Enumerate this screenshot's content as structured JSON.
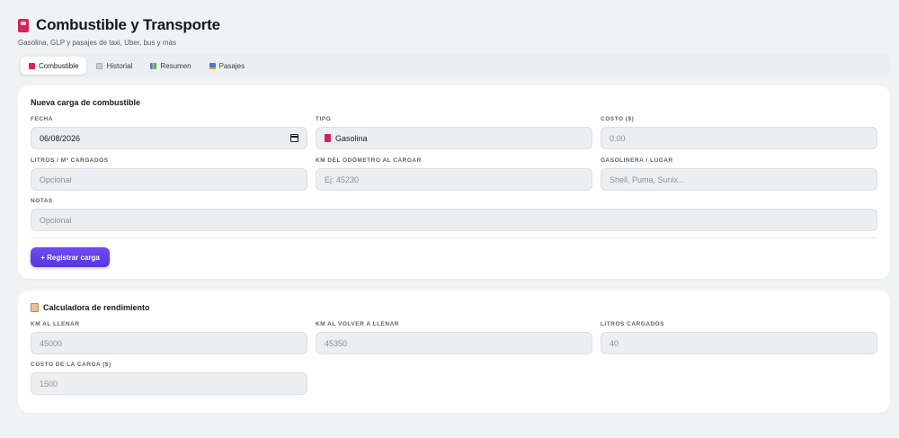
{
  "header": {
    "title": "Combustible y Transporte",
    "subtitle": "Gasolina, GLP y pasajes de taxi, Uber, bus y más"
  },
  "tabs": [
    {
      "label": "Combustible",
      "icon": "fuel-pump-icon",
      "active": true
    },
    {
      "label": "Historial",
      "icon": "clipboard-icon",
      "active": false
    },
    {
      "label": "Resumen",
      "icon": "bar-chart-icon",
      "active": false
    },
    {
      "label": "Pasajes",
      "icon": "bus-icon",
      "active": false
    }
  ],
  "fuel_form": {
    "title": "Nueva carga de combustible",
    "fecha": {
      "label": "FECHA",
      "value": "06/08/2026"
    },
    "tipo": {
      "label": "TIPO",
      "value": "Gasolina"
    },
    "costo": {
      "label": "COSTO ($)",
      "placeholder": "0.00"
    },
    "litros": {
      "label": "LITROS / M³ CARGADOS",
      "placeholder": "Opcional"
    },
    "km": {
      "label": "KM DEL ODÓMETRO AL CARGAR",
      "placeholder": "Ej: 45230"
    },
    "gasolinera": {
      "label": "GASOLINERA / LUGAR",
      "placeholder": "Shell, Puma, Sunix..."
    },
    "notas": {
      "label": "NOTAS",
      "placeholder": "Opcional"
    },
    "submit_label": "+ Registrar carga"
  },
  "calculator": {
    "title": "Calculadora de rendimiento",
    "km_llenar": {
      "label": "KM AL LLENAR",
      "placeholder": "45000"
    },
    "km_volver": {
      "label": "KM AL VOLVER A LLENAR",
      "placeholder": "45350"
    },
    "litros": {
      "label": "LITROS CARGADOS",
      "placeholder": "40"
    },
    "costo": {
      "label": "COSTO DE LA CARGA ($)",
      "placeholder": "1500"
    }
  },
  "colors": {
    "accent": "#5836e3",
    "fuel_icon": "#d6245a",
    "background": "#f1f2f4"
  }
}
